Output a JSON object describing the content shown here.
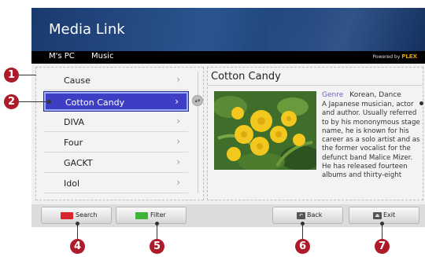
{
  "app": {
    "title": "Media Link"
  },
  "nav": {
    "items": [
      {
        "label": "M's PC"
      },
      {
        "label": "Music"
      }
    ],
    "powered_by": "Powered by",
    "brand": "PLEX"
  },
  "artist_list": {
    "items": [
      {
        "label": "Cause",
        "selected": false
      },
      {
        "label": "Cotton Candy",
        "selected": true
      },
      {
        "label": "DIVA",
        "selected": false
      },
      {
        "label": "Four",
        "selected": false
      },
      {
        "label": "GACKT",
        "selected": false
      },
      {
        "label": "Idol",
        "selected": false
      }
    ],
    "chevron": "›"
  },
  "detail": {
    "title": "Cotton Candy",
    "genre_label": "Genre",
    "genre_value": "Korean, Dance",
    "bio": "A Japanese musician, actor and author. Usually referred to by his mononymous stage name, he is known for his career as a solo artist and as the former vocalist for the defunct band Malice Mizer. He has released fourteen albums and thirty-eight"
  },
  "buttons": {
    "search": {
      "label": "Search",
      "color": "#d8262b"
    },
    "filter": {
      "label": "Filter",
      "color": "#3cb437"
    },
    "back": {
      "label": "Back",
      "icon": "back-icon"
    },
    "exit": {
      "label": "Exit",
      "icon": "exit-icon"
    }
  },
  "callouts": {
    "c1": "1",
    "c2": "2",
    "c4": "4",
    "c5": "5",
    "c6": "6",
    "c7": "7"
  },
  "colors": {
    "header": "#1f4780",
    "selection": "#3e3ec4",
    "callout": "#ad1a2a",
    "genre_label": "#6d63b8"
  }
}
